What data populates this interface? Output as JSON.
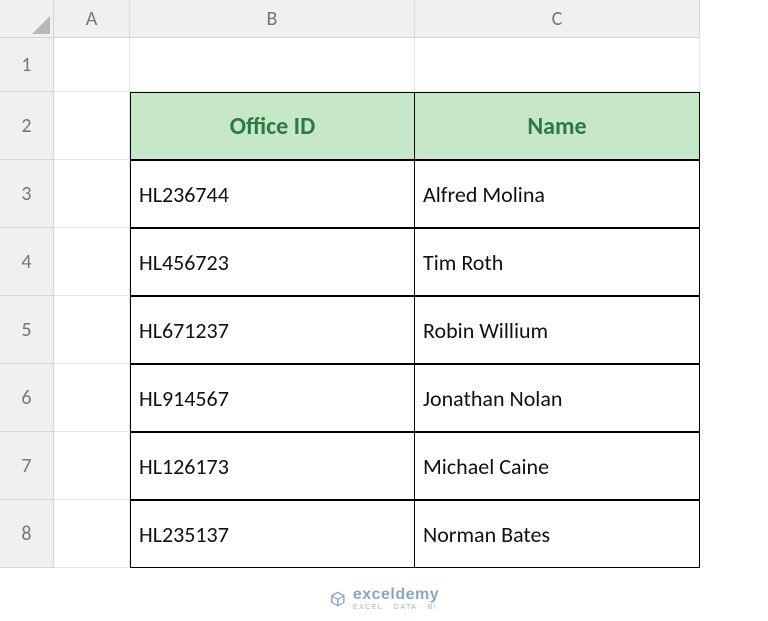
{
  "columns": {
    "A": "A",
    "B": "B",
    "C": "C"
  },
  "rows": [
    "1",
    "2",
    "3",
    "4",
    "5",
    "6",
    "7",
    "8"
  ],
  "table": {
    "headers": {
      "office_id": "Office ID",
      "name": "Name"
    },
    "data": [
      {
        "office_id": "HL236744",
        "name": "Alfred Molina"
      },
      {
        "office_id": "HL456723",
        "name": "Tim Roth"
      },
      {
        "office_id": "HL671237",
        "name": "Robin Willium"
      },
      {
        "office_id": "HL914567",
        "name": "Jonathan Nolan"
      },
      {
        "office_id": "HL126173",
        "name": "Michael Caine"
      },
      {
        "office_id": "HL235137",
        "name": "Norman Bates"
      }
    ]
  },
  "watermark": {
    "brand": "exceldemy",
    "tagline": "EXCEL · DATA · BI"
  }
}
